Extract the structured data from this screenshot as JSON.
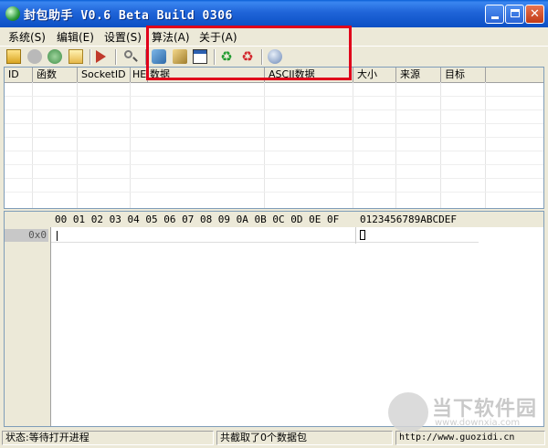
{
  "window": {
    "title": "封包助手 V0.6 Beta Build 0306",
    "icon": "app-globe-icon",
    "controls": [
      "minimize-icon",
      "maximize-icon",
      "close-icon"
    ]
  },
  "menu": {
    "items": [
      {
        "label": "系统(S)"
      },
      {
        "label": "编辑(E)"
      },
      {
        "label": "设置(S)"
      },
      {
        "label": "算法(A)"
      },
      {
        "label": "关于(A)"
      }
    ]
  },
  "toolbar": {
    "icons": [
      "open-icon",
      "stop-icon",
      "refresh-icon",
      "folder-icon",
      "play-icon",
      "search-icon",
      "process-icon",
      "tools-icon",
      "window-icon",
      "recycle-green-icon",
      "recycle-red-icon",
      "info-icon"
    ]
  },
  "packet_list": {
    "columns": [
      "ID",
      "函数",
      "SocketID",
      "HE",
      "数据",
      "ASCII数据",
      "大小",
      "来源",
      "目标"
    ]
  },
  "hex_view": {
    "header_hex": "00 01 02 03 04 05 06 07 08 09 0A 0B 0C 0D 0E 0F",
    "header_ascii": "0123456789ABCDEF",
    "row_label": "0x0"
  },
  "status": {
    "state": "状态:等待打开进程",
    "count": "共截取了0个数据包",
    "url": "http://www.guozidi.cn"
  },
  "watermark": {
    "text": "当下软件园",
    "url": "www.downxia.com"
  },
  "colors": {
    "highlight_box": "#e0001a",
    "titlebar": "#0b4fc4"
  }
}
